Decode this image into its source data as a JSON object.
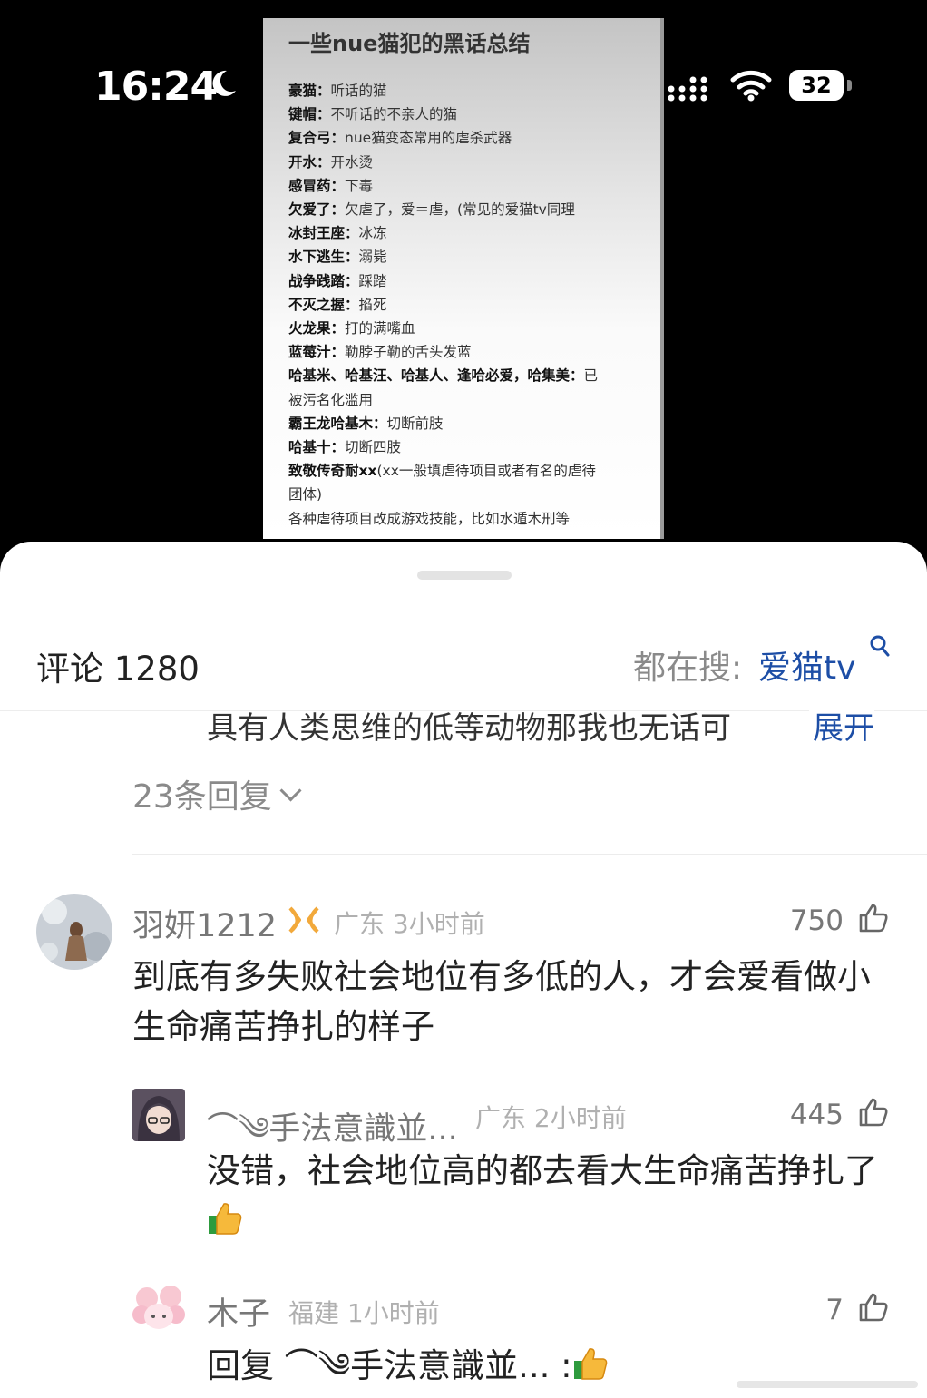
{
  "status_bar": {
    "time": "16:24",
    "battery": "32"
  },
  "notice": {
    "title": "一些nue猫犯的黑话总结",
    "lines": [
      {
        "term": "豪猫：",
        "meaning": "听话的猫"
      },
      {
        "term": "键帽：",
        "meaning": "不听话的不亲人的猫"
      },
      {
        "term": "复合弓：",
        "meaning": "nue猫变态常用的虐杀武器"
      },
      {
        "term": "开水：",
        "meaning": "开水烫"
      },
      {
        "term": "感冒药：",
        "meaning": "下毒"
      },
      {
        "term": "欠爱了：",
        "meaning": "欠虐了，爱＝虐，(常见的爱猫tv同理"
      },
      {
        "term": "冰封王座：",
        "meaning": "冰冻"
      },
      {
        "term": "水下逃生：",
        "meaning": "溺毙"
      },
      {
        "term": "战争践踏：",
        "meaning": "踩踏"
      },
      {
        "term": "不灭之握：",
        "meaning": "掐死"
      },
      {
        "term": "火龙果：",
        "meaning": "打的满嘴血"
      },
      {
        "term": "蓝莓汁：",
        "meaning": "勒脖子勒的舌头发蓝"
      },
      {
        "term": "哈基米、哈基汪、哈基人、逢哈必爱，哈集美：",
        "meaning": "已"
      },
      {
        "term": "",
        "meaning": "被污名化滥用"
      },
      {
        "term": "霸王龙哈基木：",
        "meaning": "切断前肢"
      },
      {
        "term": "哈基十：",
        "meaning": "切断四肢"
      },
      {
        "term": "致敬传奇耐xx",
        "meaning": "(xx一般填虐待项目或者有名的虐待"
      },
      {
        "term": "",
        "meaning": "团体)"
      },
      {
        "term": "",
        "meaning": "各种虐待项目改成游戏技能，比如水遁木刑等"
      }
    ]
  },
  "header": {
    "comment_count": "评论 1280",
    "search_label": "都在搜:",
    "search_term": "爱猫tv"
  },
  "previous": {
    "truncated_text": "具有人类思维的低等动物那我也无话可",
    "expand_label": "展开",
    "replies_toggle": "23条回复"
  },
  "comments": [
    {
      "user": "羽妍1212",
      "location": "广东",
      "time": "3小时前",
      "likes": "750",
      "text": "到底有多失败社会地位有多低的人，才会爱看做小生命痛苦挣扎的样子"
    },
    {
      "user": "⌒༄手法意識並...",
      "location": "广东",
      "time": "2小时前",
      "likes": "445",
      "text": "没错，社会地位高的都去看大生命痛苦挣扎了"
    },
    {
      "user": "木子",
      "location": "福建",
      "time": "1小时前",
      "likes": "7",
      "text_prefix": "回复",
      "reply_to": "⌒༄手法意識並...",
      "text_suffix": ":"
    }
  ],
  "icons": {
    "thumb": "thumbs-up-outline-icon",
    "badge": "vip-ribbon-badge-icon",
    "emoji": "thumbs-up-emoji"
  }
}
